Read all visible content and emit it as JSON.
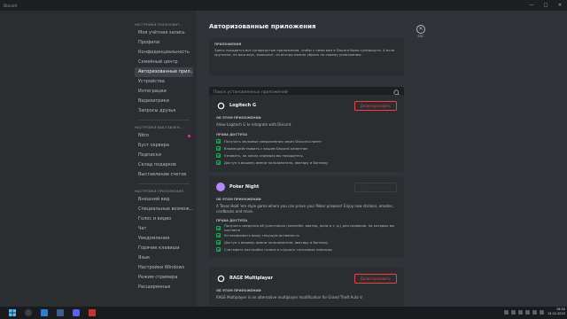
{
  "window": {
    "title": "Discord"
  },
  "sidebar": {
    "sections": [
      {
        "header": "Настройки пользоват...",
        "items": [
          "Моя учётная запись",
          "Профили",
          "Конфиденциальность",
          "Семейный центр",
          "Авторизованные прил...",
          "Устройства",
          "Интеграции",
          "Видеоигрики",
          "Запросы друзья"
        ]
      },
      {
        "header": "Настройки выставлен...",
        "items": [
          "Nitro",
          "Буст сервера",
          "Подписки",
          "Склад подарков",
          "Выставление счетов"
        ]
      },
      {
        "header": "Настройки приложения",
        "items": [
          "Внешний вид",
          "Специальные возмож...",
          "Голос и видео",
          "Чат",
          "Уведомления",
          "Горячие клавиши",
          "Язык",
          "Настройки Windows",
          "Режим стримера",
          "Расширенные"
        ]
      }
    ],
    "active_item": "Авторизованные прил..."
  },
  "main": {
    "title": "Авторизованные приложения",
    "esc_label": "ESC",
    "info": {
      "heading": "Приложения",
      "text": "Здесь находятся все суперкрутые приложения, чтобы с ними вам в Discord было суперкруто. А если крутизна, на ваш вкус, зашкалит, из всегда можно убрать по своему усмотрению."
    },
    "search": {
      "placeholder": "Поиск установленных приложений"
    },
    "apps": [
      {
        "name": "Logitech G",
        "about_label": "Об этом приложении",
        "description": "Allow Logitech G to integrate with Discord.",
        "perms_label": "Права доступа",
        "permissions": [
          "Получать звуковые уведомления через Discord-клиент",
          "Взаимодействовать с вашим Discord-клиентом",
          "Узнавать, на каких серверах вы находитесь",
          "Доступ к вашему имени пользователя, аватару и баннеру"
        ],
        "button": "Деавторизовать",
        "logo_color": "#ffffff"
      },
      {
        "name": "Poker Night",
        "about_label": "Об этом приложении",
        "description": "A Texas Hold 'em style game where you can prove your Poker prowess! Enjoy new stickers, emotes, cardbacks and more.",
        "perms_label": "Права доступа",
        "permissions": [
          "Получать сведения об участниках (никнейм, аватар, роли и т. д.) для серверов, на которых вы состоите",
          "Устанавливать вашу текущую активность",
          "Доступ к вашему имени пользователя, аватару и баннеру",
          "Считывать настройки голоса и слушать голосовые команды"
        ],
        "button": "Деавторизовать",
        "logo_color": "#b388ff"
      },
      {
        "name": "RAGE Multiplayer",
        "about_label": "Об этом приложении",
        "description": "RAGE Multiplayer is an alternative multiplayer modification for Grand Theft Auto V.",
        "button": "Деавторизовать",
        "logo_color": "#ffffff"
      }
    ]
  },
  "taskbar": {
    "time": "16:50",
    "date": "13.02.2025"
  }
}
